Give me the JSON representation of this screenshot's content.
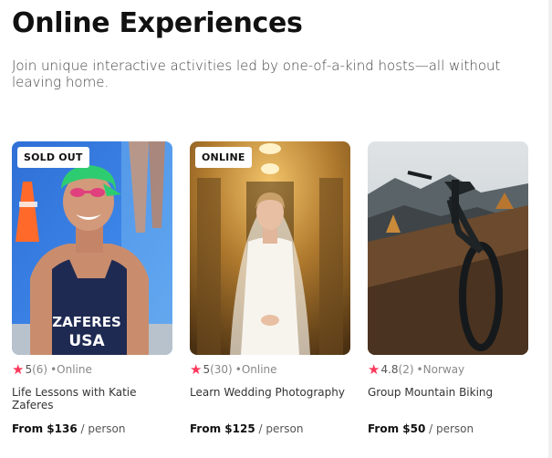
{
  "header": {
    "title": "Online Experiences",
    "subtitle": "Join unique interactive activities led by one-of-a-kind hosts—all without leaving home."
  },
  "cards": [
    {
      "badge": "SOLD OUT",
      "image_icon": "athlete-photo",
      "rating": "5",
      "count": "(6)",
      "separator": "•",
      "location": "Online",
      "title": "Life Lessons with Katie Zaferes",
      "price": "From $136",
      "unit": " / person"
    },
    {
      "badge": "ONLINE",
      "image_icon": "bride-photo",
      "rating": "5",
      "count": "(30)",
      "separator": "•",
      "location": "Online",
      "title": "Learn Wedding Photography",
      "price": "From $125",
      "unit": " / person"
    },
    {
      "badge": "",
      "image_icon": "mountain-bike-photo",
      "rating": "4.8",
      "count": "(2)",
      "separator": "•",
      "location": "Norway",
      "title": "Group Mountain Biking",
      "price": "From $50",
      "unit": " / person"
    }
  ],
  "colors": {
    "star": "#ff385c",
    "text": "#222222",
    "muted": "#888888"
  }
}
